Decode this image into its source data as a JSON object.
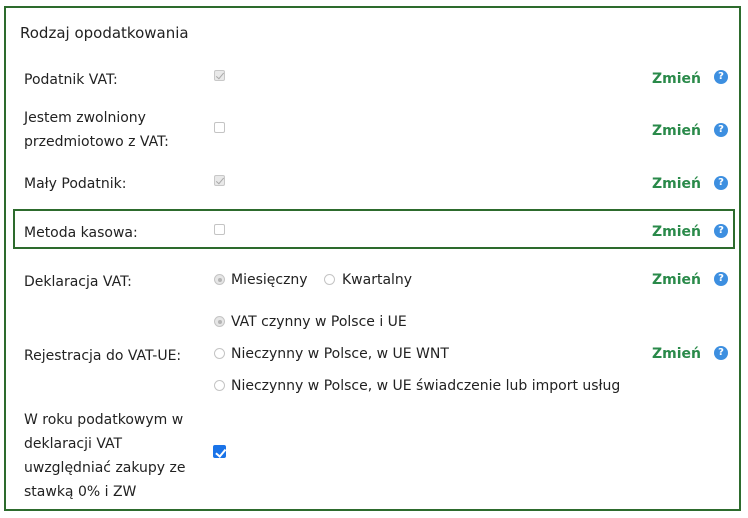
{
  "title": "Rodzaj opodatkowania",
  "change_label": "Zmień",
  "help_glyph": "?",
  "colors": {
    "border": "#2d6b2d",
    "change_link": "#2a8a4a",
    "help": "#3d8fe0",
    "checkbox_active": "#1a73e8"
  },
  "rows": {
    "podatnik_vat": {
      "label": "Podatnik VAT:",
      "checked": true,
      "disabled": true
    },
    "zwolniony": {
      "label_line1": "Jestem zwolniony",
      "label_line2": "przedmiotowo z VAT:",
      "checked": false,
      "disabled": true
    },
    "maly_podatnik": {
      "label": "Mały Podatnik:",
      "checked": true,
      "disabled": true
    },
    "metoda_kasowa": {
      "label": "Metoda kasowa:",
      "checked": false,
      "disabled": true
    },
    "deklaracja_vat": {
      "label": "Deklaracja VAT:",
      "options": [
        "Miesięczny",
        "Kwartalny"
      ],
      "selected": "Miesięczny"
    },
    "rejestracja": {
      "label": "Rejestracja do VAT-UE:",
      "options": [
        "VAT czynny w Polsce i UE",
        "Nieczynny w Polsce, w UE WNT",
        "Nieczynny w Polsce, w UE świadczenie lub import usług"
      ],
      "selected": "VAT czynny w Polsce i UE"
    },
    "zakupy": {
      "label_line1": "W roku podatkowym w",
      "label_line2": "deklaracji VAT",
      "label_line3": "uwzględniać zakupy ze",
      "label_line4": "stawką 0% i ZW",
      "checked": true
    }
  }
}
